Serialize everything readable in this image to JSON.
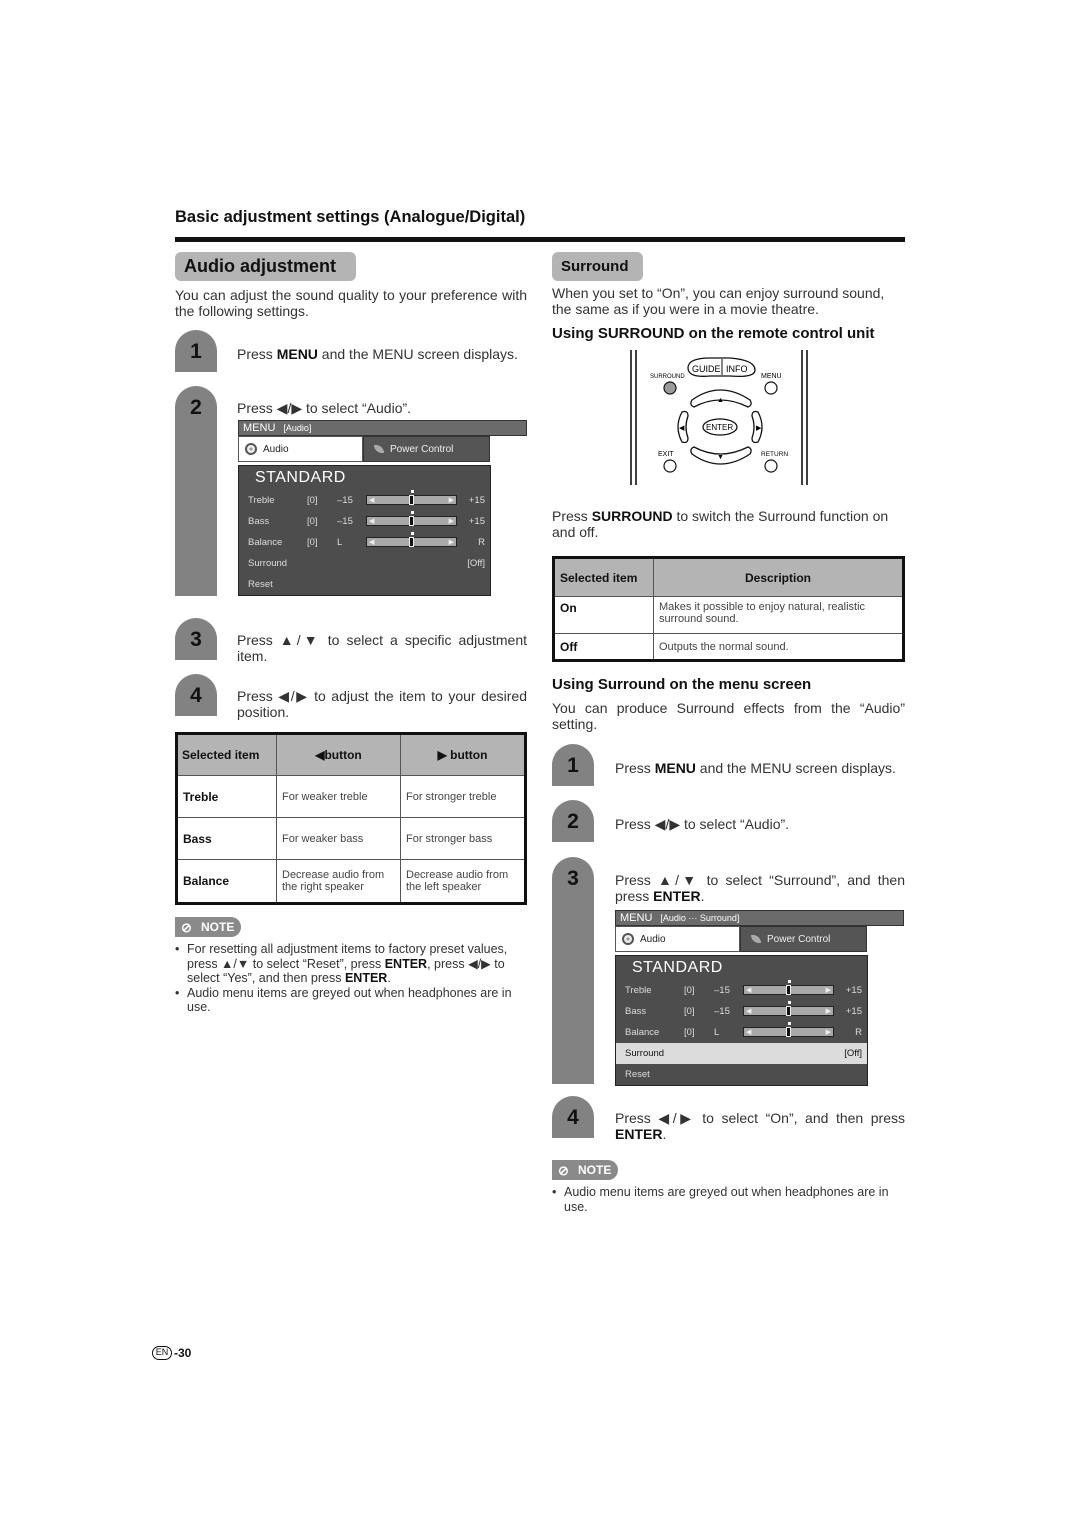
{
  "section_title": "Basic adjustment settings (Analogue/Digital)",
  "audio": {
    "title": "Audio adjustment",
    "intro": "You can adjust the sound quality to your preference with the following settings.",
    "steps": [
      {
        "num": "1",
        "text_pre": "Press ",
        "bold": "MENU",
        "text_post": " and the MENU screen displays."
      },
      {
        "num": "2",
        "text": "Press ◀/▶ to select “Audio”."
      },
      {
        "num": "3",
        "text": "Press ▲/▼ to select a specific adjustment item."
      },
      {
        "num": "4",
        "text": "Press ◀/▶ to adjust the item to your desired position."
      }
    ],
    "menu": {
      "bar_label": "MENU",
      "breadcrumb": "[Audio]",
      "tab_audio": "Audio",
      "tab_power": "Power Control",
      "mode": "STANDARD",
      "rows": [
        {
          "label": "Treble",
          "value": "[0]",
          "min": "–15",
          "max": "+15",
          "level": 0.5
        },
        {
          "label": "Bass",
          "value": "[0]",
          "min": "–15",
          "max": "+15",
          "level": 0.5
        },
        {
          "label": "Balance",
          "value": "[0]",
          "min": "L",
          "max": "R",
          "level": 0.5
        }
      ],
      "surround_label": "Surround",
      "surround_value": "[Off]",
      "reset_label": "Reset"
    },
    "table": {
      "headers": [
        "Selected item",
        "◀button",
        "▶ button"
      ],
      "rows": [
        [
          "Treble",
          "For weaker treble",
          "For stronger treble"
        ],
        [
          "Bass",
          "For weaker bass",
          "For stronger bass"
        ],
        [
          "Balance",
          "Decrease audio from the right speaker",
          "Decrease audio from the left speaker"
        ]
      ]
    },
    "note_label": "NOTE",
    "notes": [
      {
        "parts": [
          "For resetting all adjustment items to factory preset values, press ▲/▼ to select “Reset”, press ",
          "ENTER",
          ", press ◀/▶ to select “Yes”, and then press ",
          "ENTER",
          "."
        ]
      },
      {
        "parts": [
          "Audio menu items are greyed out when headphones are in use."
        ]
      }
    ]
  },
  "surround": {
    "title": "Surround",
    "intro": "When you set to “On”, you can enjoy surround sound, the same as if you were in a movie theatre.",
    "remote_heading": "Using SURROUND on the remote control unit",
    "remote_labels": {
      "surround": "SURROUND",
      "guide": "GUIDE",
      "info": "INFO",
      "menu": "MENU",
      "enter": "ENTER",
      "exit": "EXIT",
      "return": "RETURN"
    },
    "remote_text_pre": "Press ",
    "remote_text_bold": "SURROUND",
    "remote_text_post": " to switch the Surround function on and off.",
    "table": {
      "headers": [
        "Selected item",
        "Description"
      ],
      "rows": [
        [
          "On",
          "Makes it possible to enjoy natural, realistic surround sound."
        ],
        [
          "Off",
          "Outputs the normal sound."
        ]
      ]
    },
    "menu_heading": "Using Surround on the menu screen",
    "menu_intro": "You can produce Surround effects from the “Audio” setting.",
    "steps": [
      {
        "num": "1",
        "text_pre": "Press ",
        "bold": "MENU",
        "text_post": " and the MENU screen displays."
      },
      {
        "num": "2",
        "text": "Press ◀/▶ to select “Audio”."
      },
      {
        "num": "3",
        "text_pre": "Press ▲/▼ to select “Surround”, and then press ",
        "bold": "ENTER",
        "text_post": "."
      },
      {
        "num": "4",
        "text_pre": "Press ◀/▶ to select “On”, and then press ",
        "bold": "ENTER",
        "text_post": "."
      }
    ],
    "menu": {
      "bar_label": "MENU",
      "breadcrumb": "[Audio ··· Surround]",
      "tab_audio": "Audio",
      "tab_power": "Power Control",
      "mode": "STANDARD",
      "rows": [
        {
          "label": "Treble",
          "value": "[0]",
          "min": "–15",
          "max": "+15",
          "level": 0.5
        },
        {
          "label": "Bass",
          "value": "[0]",
          "min": "–15",
          "max": "+15",
          "level": 0.5
        },
        {
          "label": "Balance",
          "value": "[0]",
          "min": "L",
          "max": "R",
          "level": 0.5
        }
      ],
      "surround_label": "Surround",
      "surround_value": "[Off]",
      "reset_label": "Reset"
    },
    "note_label": "NOTE",
    "notes": [
      {
        "parts": [
          "Audio menu items are greyed out when headphones are in use."
        ]
      }
    ]
  },
  "footer": {
    "lang": "EN",
    "page": "-30"
  }
}
